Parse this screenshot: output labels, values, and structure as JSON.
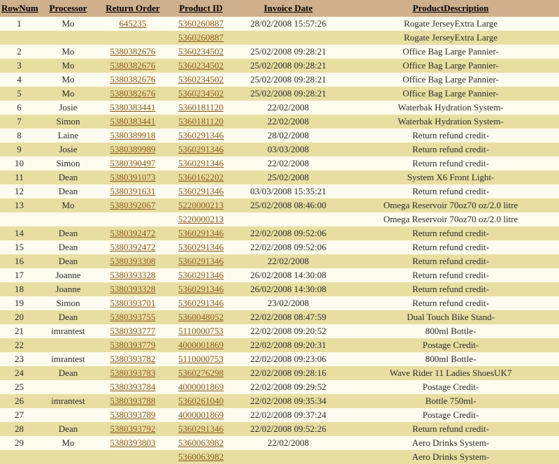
{
  "headers": {
    "rownum": "RowNum",
    "processor": "Processor",
    "return_order": "Return Order",
    "product_id": "Product ID",
    "invoice_date": "Invoice Date",
    "product_desc": "ProductDescription"
  },
  "rows": [
    {
      "rownum": "1",
      "processor": "Mo",
      "return_order": "645235",
      "product_id": "5360260887",
      "invoice_date": "28/02/2008 15:57:26",
      "desc": "Rogate JerseyExtra Large"
    },
    {
      "rownum": "",
      "processor": "",
      "return_order": "",
      "product_id": "5360260887",
      "invoice_date": "",
      "desc": "Rogate JerseyExtra Large"
    },
    {
      "rownum": "2",
      "processor": "Mo",
      "return_order": "5380382676",
      "product_id": "5360234502",
      "invoice_date": "25/02/2008 09:28:21",
      "desc": "Office Bag Large Pannier-"
    },
    {
      "rownum": "3",
      "processor": "Mo",
      "return_order": "5380382676",
      "product_id": "5360234502",
      "invoice_date": "25/02/2008 09:28:21",
      "desc": "Office Bag Large Pannier-"
    },
    {
      "rownum": "4",
      "processor": "Mo",
      "return_order": "5380382676",
      "product_id": "5360234502",
      "invoice_date": "25/02/2008 09:28:21",
      "desc": "Office Bag Large Pannier-"
    },
    {
      "rownum": "5",
      "processor": "Mo",
      "return_order": "5380382676",
      "product_id": "5360234502",
      "invoice_date": "25/02/2008 09:28:21",
      "desc": "Office Bag Large Pannier-"
    },
    {
      "rownum": "6",
      "processor": "Josie",
      "return_order": "5380383441",
      "product_id": "5360181120",
      "invoice_date": "22/02/2008",
      "desc": "Waterbak Hydration System-"
    },
    {
      "rownum": "7",
      "processor": "Simon",
      "return_order": "5380383441",
      "product_id": "5360181120",
      "invoice_date": "22/02/2008",
      "desc": "Waterbak Hydration System-"
    },
    {
      "rownum": "8",
      "processor": "Laine",
      "return_order": "5380389918",
      "product_id": "5360291346",
      "invoice_date": "28/02/2008",
      "desc": "Return refund credit-"
    },
    {
      "rownum": "9",
      "processor": "Josie",
      "return_order": "5380389989",
      "product_id": "5360291346",
      "invoice_date": "03/03/2008",
      "desc": "Return refund credit-"
    },
    {
      "rownum": "10",
      "processor": "Simon",
      "return_order": "5380390497",
      "product_id": "5360291346",
      "invoice_date": "22/02/2008",
      "desc": "Return refund credit-"
    },
    {
      "rownum": "11",
      "processor": "Dean",
      "return_order": "5380391073",
      "product_id": "5360162202",
      "invoice_date": "25/02/2008",
      "desc": "System X6 Front Light-"
    },
    {
      "rownum": "12",
      "processor": "Dean",
      "return_order": "5380391631",
      "product_id": "5360291346",
      "invoice_date": "03/03/2008 15:35:21",
      "desc": "Return refund credit-"
    },
    {
      "rownum": "13",
      "processor": "Mo",
      "return_order": "5380392067",
      "product_id": "5220000213",
      "invoice_date": "25/02/2008 08:46:00",
      "desc": "Omega Reservoir 70oz70 oz/2.0 litre"
    },
    {
      "rownum": "",
      "processor": "",
      "return_order": "",
      "product_id": "5220000213",
      "invoice_date": "",
      "desc": "Omega Reservoir 70oz70 oz/2.0 litre"
    },
    {
      "rownum": "14",
      "processor": "Dean",
      "return_order": "5380392472",
      "product_id": "5360291346",
      "invoice_date": "22/02/2008 09:52:06",
      "desc": "Return refund credit-"
    },
    {
      "rownum": "15",
      "processor": "Dean",
      "return_order": "5380392472",
      "product_id": "5360291346",
      "invoice_date": "22/02/2008 09:52:06",
      "desc": "Return refund credit-"
    },
    {
      "rownum": "16",
      "processor": "Dean",
      "return_order": "5380393308",
      "product_id": "5360291346",
      "invoice_date": "22/02/2008",
      "desc": "Return refund credit-"
    },
    {
      "rownum": "17",
      "processor": "Joanne",
      "return_order": "5380393328",
      "product_id": "5360291346",
      "invoice_date": "26/02/2008 14:30:08",
      "desc": "Return refund credit-"
    },
    {
      "rownum": "18",
      "processor": "Joanne",
      "return_order": "5380393328",
      "product_id": "5360291346",
      "invoice_date": "26/02/2008 14:30:08",
      "desc": "Return refund credit-"
    },
    {
      "rownum": "19",
      "processor": "Simon",
      "return_order": "5380393701",
      "product_id": "5360291346",
      "invoice_date": "23/02/2008",
      "desc": "Return refund credit-"
    },
    {
      "rownum": "20",
      "processor": "Dean",
      "return_order": "5380393755",
      "product_id": "5360048052",
      "invoice_date": "22/02/2008 08:47:59",
      "desc": "Dual Touch Bike Stand-"
    },
    {
      "rownum": "21",
      "processor": "imrantest",
      "return_order": "5380393777",
      "product_id": "5110000753",
      "invoice_date": "22/02/2008 09:20:52",
      "desc": "800ml Bottle-"
    },
    {
      "rownum": "22",
      "processor": "",
      "return_order": "5380393779",
      "product_id": "4000001869",
      "invoice_date": "22/02/2008 09:20:31",
      "desc": "Postage Credit-"
    },
    {
      "rownum": "23",
      "processor": "imrantest",
      "return_order": "5380393782",
      "product_id": "5110000753",
      "invoice_date": "22/02/2008 09:23:06",
      "desc": "800ml Bottle-"
    },
    {
      "rownum": "24",
      "processor": "Dean",
      "return_order": "5380393783",
      "product_id": "5360276298",
      "invoice_date": "22/02/2008 09:28:16",
      "desc": "Wave Rider 11 Ladies ShoesUK7"
    },
    {
      "rownum": "25",
      "processor": "",
      "return_order": "5380393784",
      "product_id": "4000001869",
      "invoice_date": "22/02/2008 09:29:52",
      "desc": "Postage Credit-"
    },
    {
      "rownum": "26",
      "processor": "imrantest",
      "return_order": "5380393788",
      "product_id": "5360261040",
      "invoice_date": "22/02/2008 09:35:34",
      "desc": "Bottle 750ml-"
    },
    {
      "rownum": "27",
      "processor": "",
      "return_order": "5380393789",
      "product_id": "4000001869",
      "invoice_date": "22/02/2008 09:37:24",
      "desc": "Postage Credit-"
    },
    {
      "rownum": "28",
      "processor": "Dean",
      "return_order": "5380393792",
      "product_id": "5360291346",
      "invoice_date": "22/02/2008 09:52:26",
      "desc": "Return refund credit-"
    },
    {
      "rownum": "29",
      "processor": "Mo",
      "return_order": "5380393803",
      "product_id": "5360063982",
      "invoice_date": "22/02/2008",
      "desc": "Aero Drinks System-"
    },
    {
      "rownum": "",
      "processor": "",
      "return_order": "",
      "product_id": "5360063982",
      "invoice_date": "",
      "desc": "Aero Drinks System-"
    }
  ]
}
